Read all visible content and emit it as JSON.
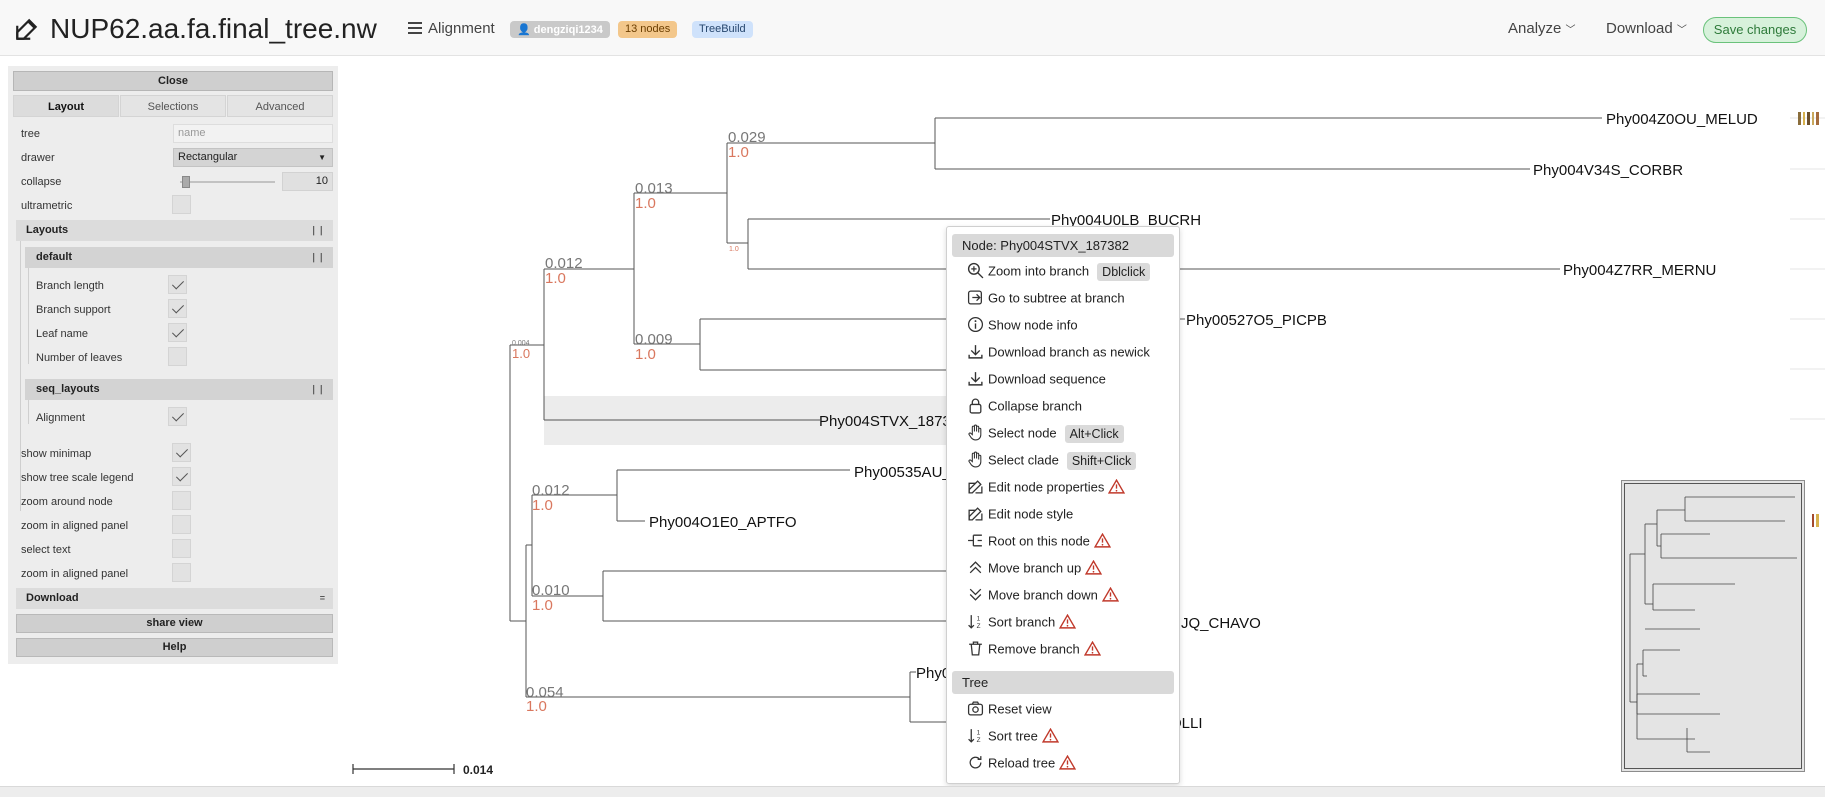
{
  "header": {
    "title": "NUP62.aa.fa.final_tree.nw",
    "menu_label": "Alignment",
    "user_badge": "dengziqi1234",
    "nodes_badge": "13 nodes",
    "tree_badge": "TreeBuild",
    "analyze_label": "Analyze",
    "download_label": "Download",
    "save_label": "Save changes",
    "icons": {
      "edit": "edit-icon",
      "menu": "hamburger-icon",
      "dropdown": "chevron-down-icon"
    }
  },
  "panel": {
    "close_label": "Close",
    "tabs": [
      "Layout",
      "Selections",
      "Advanced"
    ],
    "active_tab": "Layout",
    "tree_label": "tree",
    "tree_placeholder": "name",
    "drawer_label": "drawer",
    "drawer_value": "Rectangular",
    "collapse_label": "collapse",
    "collapse_value": "10",
    "ultrametric_label": "ultrametric",
    "layouts_title": "Layouts",
    "default_title": "default",
    "default_items": [
      {
        "label": "Branch length",
        "checked": true
      },
      {
        "label": "Branch support",
        "checked": true
      },
      {
        "label": "Leaf name",
        "checked": true
      },
      {
        "label": "Number of leaves",
        "checked": false
      }
    ],
    "seq_title": "seq_layouts",
    "seq_items": [
      {
        "label": "Alignment",
        "checked": true
      }
    ],
    "options": [
      {
        "label": "show minimap",
        "checked": true
      },
      {
        "label": "show tree scale legend",
        "checked": true
      },
      {
        "label": "zoom around node",
        "checked": false
      },
      {
        "label": "zoom in aligned panel",
        "checked": false
      },
      {
        "label": "select text",
        "checked": false
      },
      {
        "label": "zoom in aligned panel",
        "checked": false
      }
    ],
    "download_title": "Download",
    "share_label": "share view",
    "help_label": "Help"
  },
  "tree": {
    "leaves": [
      "Phy004Z0OU_MELUD",
      "Phy004V34S_CORBR",
      "Phy004U0LB_BUCRH",
      "Phy004Z7RR_MERNU",
      "Phy00527O5_PICPB",
      "Phy004STVX_1873",
      "Phy00535AU_",
      "Phy004O1E0_APTFO",
      "JQ_CHAVO",
      "Phy0",
      "OLLI"
    ],
    "branch_lengths": [
      "0.029",
      "0.013",
      "0.012",
      "0.009",
      "0.004",
      "0.012",
      "0.010",
      "0.054"
    ],
    "supports": [
      "1.0",
      "1.0",
      "1.0",
      "1.0",
      "1.0",
      "1.0",
      "1.0",
      "1.0",
      "1.0"
    ],
    "scale_value": "0.014"
  },
  "context_menu": {
    "node_title": "Node: Phy004STVX_187382",
    "items": [
      {
        "label": "Zoom into branch",
        "kbd": "Dblclick",
        "icon": "zoom-in-icon",
        "warn": false
      },
      {
        "label": "Go to subtree at branch",
        "icon": "subtree-icon",
        "warn": false
      },
      {
        "label": "Show node info",
        "icon": "info-icon",
        "warn": false
      },
      {
        "label": "Download branch as newick",
        "icon": "download-icon",
        "warn": false
      },
      {
        "label": "Download sequence",
        "icon": "download-icon",
        "warn": false
      },
      {
        "label": "Collapse branch",
        "icon": "lock-icon",
        "warn": false
      },
      {
        "label": "Select node",
        "kbd": "Alt+Click",
        "icon": "hand-icon",
        "warn": false
      },
      {
        "label": "Select clade",
        "kbd": "Shift+Click",
        "icon": "hand-icon",
        "warn": false
      },
      {
        "label": "Edit node properties",
        "icon": "edit-icon",
        "warn": true
      },
      {
        "label": "Edit node style",
        "icon": "edit-icon",
        "warn": false
      },
      {
        "label": "Root on this node",
        "icon": "root-icon",
        "warn": true
      },
      {
        "label": "Move branch up",
        "icon": "chevron-up-icon",
        "warn": true
      },
      {
        "label": "Move branch down",
        "icon": "chevron-down-icon",
        "warn": true
      },
      {
        "label": "Sort branch",
        "icon": "sort-icon",
        "warn": true
      },
      {
        "label": "Remove branch",
        "icon": "trash-icon",
        "warn": true
      }
    ],
    "tree_title": "Tree",
    "tree_items": [
      {
        "label": "Reset view",
        "icon": "camera-icon",
        "warn": false
      },
      {
        "label": "Sort tree",
        "icon": "sort-icon",
        "warn": true
      },
      {
        "label": "Reload tree",
        "icon": "reload-icon",
        "warn": true
      }
    ]
  },
  "colors": {
    "support": "#d9775e",
    "length": "#777777",
    "save_bg": "#d7f1db",
    "warn": "#c0392b"
  }
}
